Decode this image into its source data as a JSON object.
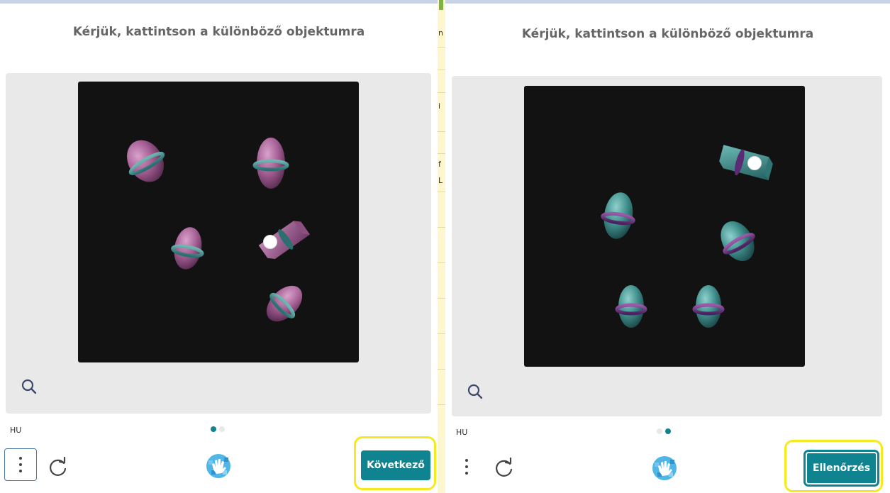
{
  "left_panel": {
    "title": "Kérjük, kattintson a különböző objektumra",
    "language": "HU",
    "page_indicator": {
      "total": 2,
      "active": 1
    },
    "primary_button": "Következő"
  },
  "right_panel": {
    "title": "Kérjük, kattintson a különböző objektumra",
    "language": "HU",
    "page_indicator": {
      "total": 2,
      "active": 2
    },
    "primary_button": "Ellenőrzés"
  },
  "background_strip_glyphs": [
    "n",
    "i",
    "f",
    "L"
  ],
  "colors": {
    "accent": "#0f8390",
    "highlight": "#f5ea1d",
    "canvas": "#121212",
    "challenge_bg": "#e9e9e9",
    "pink_object": "#b06a9e",
    "teal_object": "#3f8f8c"
  },
  "icons": {
    "zoom": "magnifier-icon",
    "menu": "vertical-dots-icon",
    "refresh": "refresh-icon",
    "logo": "hand-logo-icon"
  }
}
